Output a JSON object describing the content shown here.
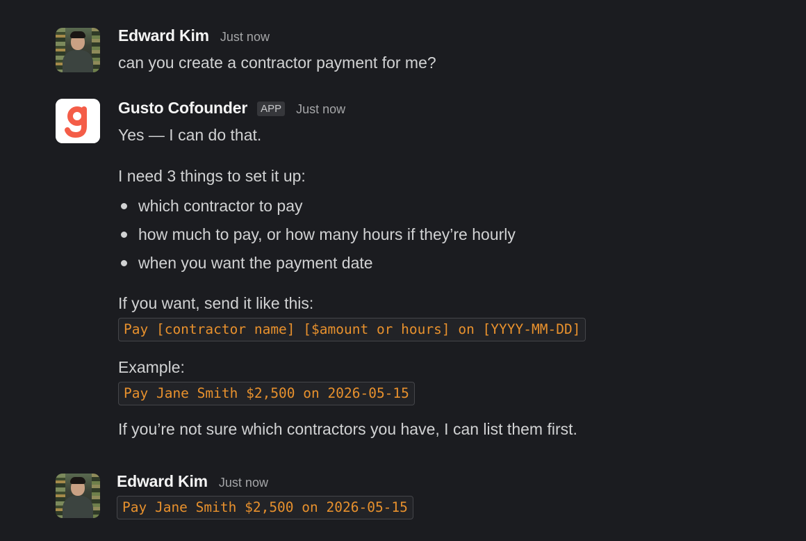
{
  "messages": [
    {
      "sender": "Edward Kim",
      "timestamp": "Just now",
      "text": "can you create a contractor payment for me?"
    },
    {
      "sender": "Gusto Cofounder",
      "badge": "APP",
      "timestamp": "Just now",
      "logo_letter": "g",
      "intro": "Yes — I can do that.",
      "needs": "I need 3 things to set it up:",
      "bullets": [
        "which contractor to pay",
        "how much to pay, or how many hours if they’re hourly",
        "when you want the payment date"
      ],
      "format_label": "If you want, send it like this:",
      "format_code": "Pay [contractor name] [$amount or hours] on [YYYY-MM-DD]",
      "example_label": "Example:",
      "example_code": "Pay Jane Smith $2,500 on 2026-05-15",
      "closing": "If you’re not sure which contractors you have, I can list them first."
    },
    {
      "sender": "Edward Kim",
      "timestamp": "Just now",
      "code": "Pay Jane Smith $2,500 on 2026-05-15"
    }
  ],
  "colors": {
    "background": "#1b1c20",
    "code_text": "#e8912d",
    "gusto_brand": "#f45d48"
  },
  "icons": {
    "user_avatar": "user-photo-avatar",
    "app_avatar": "gusto-logo-icon"
  }
}
